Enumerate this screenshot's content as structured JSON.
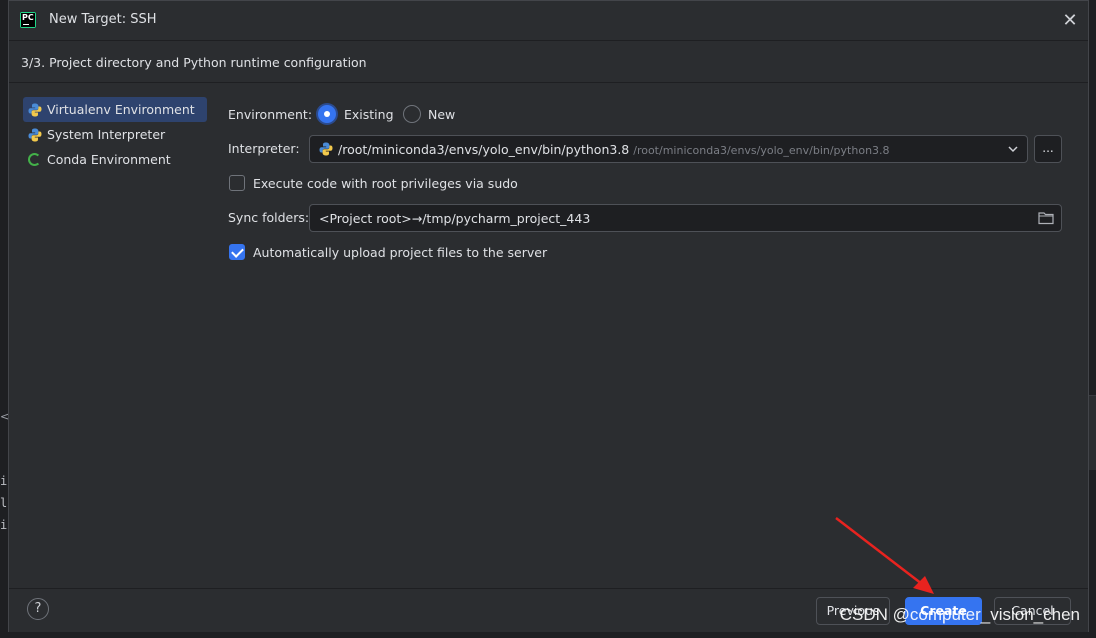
{
  "window": {
    "title": "New Target: SSH",
    "app_logo_text": "PC",
    "close_icon": "close-icon"
  },
  "step": {
    "text": "3/3. Project directory and Python runtime configuration"
  },
  "sidebar": {
    "items": [
      {
        "label": "Virtualenv Environment",
        "icon": "python-virtualenv-icon",
        "selected": true
      },
      {
        "label": "System Interpreter",
        "icon": "python-icon",
        "selected": false
      },
      {
        "label": "Conda Environment",
        "icon": "conda-icon",
        "selected": false
      }
    ]
  },
  "form": {
    "environment_label": "Environment:",
    "environment_options": [
      {
        "label": "Existing",
        "checked": true
      },
      {
        "label": "New",
        "checked": false
      }
    ],
    "interpreter_label": "Interpreter:",
    "interpreter_value": "/root/miniconda3/envs/yolo_env/bin/python3.8",
    "interpreter_hint": "/root/miniconda3/envs/yolo_env/bin/python3.8",
    "interpreter_browse": "...",
    "sudo_label": "Execute code with root privileges via sudo",
    "sudo_checked": false,
    "sync_label": "Sync folders:",
    "sync_value": "<Project root>→/tmp/pycharm_project_443",
    "auto_upload_label": "Automatically upload project files to the server",
    "auto_upload_checked": true
  },
  "footer": {
    "help": "?",
    "previous": "Previous",
    "create": "Create",
    "cancel": "Cancel"
  },
  "watermark": "CSDN @computer_vision_chen",
  "background": {
    "code_lines": [
      "i",
      "l",
      "",
      "i"
    ],
    "mark": "<"
  },
  "colors": {
    "accent": "#3574f0",
    "dialog_bg": "#2b2d30",
    "annotation_arrow": "#e8231f"
  }
}
